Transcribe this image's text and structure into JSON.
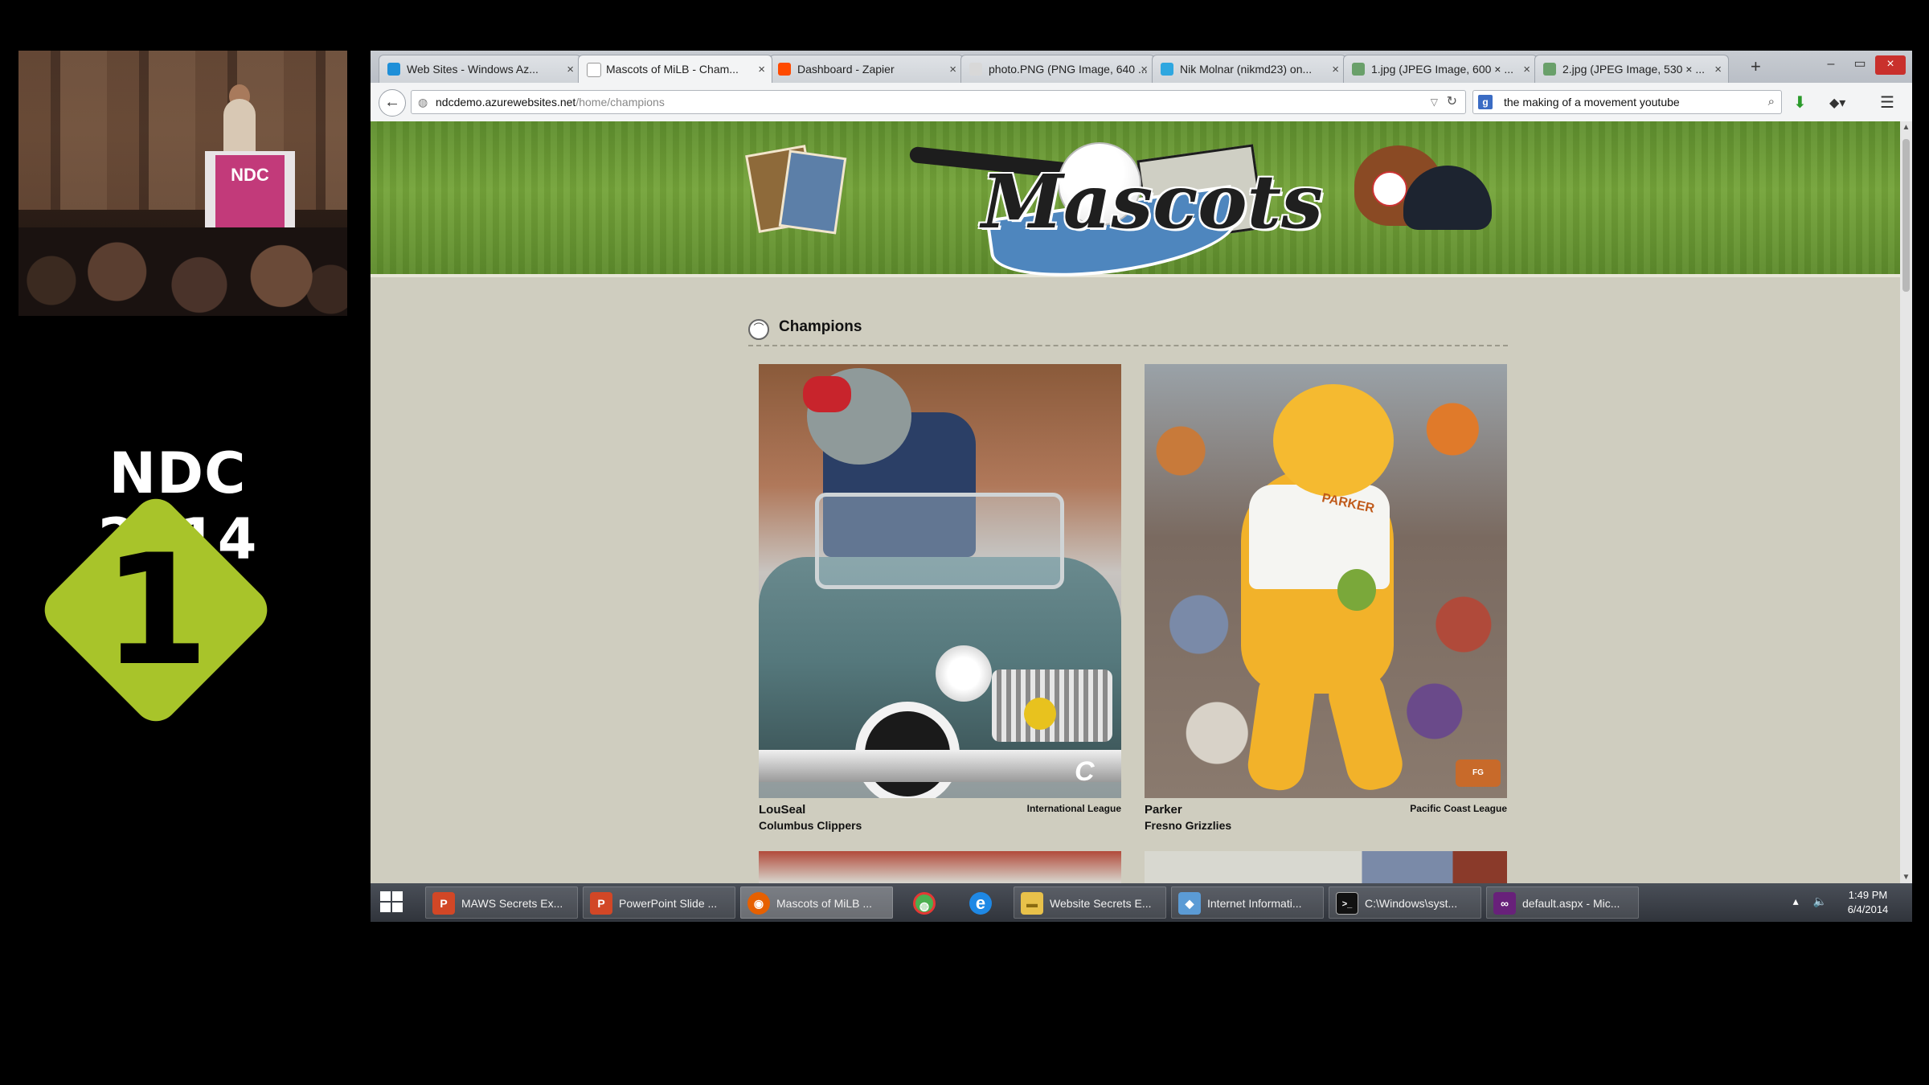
{
  "event": {
    "title": "NDC 2014",
    "badge_number": "1",
    "podium_logo": "NDC"
  },
  "browser": {
    "tabs": [
      {
        "label": "Web Sites - Windows Az...",
        "icon": "windows-azure-icon",
        "color": "#1e8fd8",
        "active": false
      },
      {
        "label": "Mascots of MiLB - Cham...",
        "icon": "baseball-icon",
        "color": "#777777",
        "active": true
      },
      {
        "label": "Dashboard - Zapier",
        "icon": "zapier-icon",
        "color": "#ff4a00",
        "active": false
      },
      {
        "label": "photo.PNG (PNG Image, 640 ...",
        "icon": "image-icon",
        "color": "#cccccc",
        "active": false
      },
      {
        "label": "Nik Molnar (nikmd23) on...",
        "icon": "twitter-icon",
        "color": "#2fa7e0",
        "active": false
      },
      {
        "label": "1.jpg (JPEG Image, 600 × ...",
        "icon": "image-icon",
        "color": "#6aa06a",
        "active": false
      },
      {
        "label": "2.jpg (JPEG Image, 530 × ...",
        "icon": "image-icon",
        "color": "#6aa06a",
        "active": false
      }
    ],
    "new_tab": "+",
    "window_controls": {
      "minimize": "–",
      "maximize": "▭",
      "close": "×"
    },
    "url": {
      "host": "ndcdemo.azurewebsites.net",
      "path": "/home/champions"
    },
    "search": {
      "value": "the making of a movement youtube",
      "engine": "g"
    }
  },
  "site": {
    "logo_text": "Mascots",
    "section_title": "Champions",
    "mascots": [
      {
        "name": "LouSeal",
        "team": "Columbus Clippers",
        "league": "International League"
      },
      {
        "name": "Parker",
        "team": "Fresno Grizzlies",
        "league": "Pacific Coast League",
        "shirt_text": "PARKER"
      }
    ]
  },
  "taskbar": {
    "items": [
      {
        "label": "MAWS Secrets Ex...",
        "icon": "powerpoint-icon",
        "color": "#d24726",
        "glyph": "P"
      },
      {
        "label": "PowerPoint Slide ...",
        "icon": "powerpoint-icon",
        "color": "#d24726",
        "glyph": "P"
      },
      {
        "label": "Mascots of MiLB ...",
        "icon": "firefox-icon",
        "color": "#e66000",
        "glyph": "◉"
      },
      {
        "label": "",
        "icon": "chrome-icon",
        "color": "#4caf50",
        "glyph": "◍"
      },
      {
        "label": "",
        "icon": "internet-explorer-icon",
        "color": "#1e88e5",
        "glyph": "e"
      },
      {
        "label": "Website Secrets E...",
        "icon": "folder-icon",
        "color": "#e8c14a",
        "glyph": "▬"
      },
      {
        "label": "Internet Informati...",
        "icon": "iis-icon",
        "color": "#5b9bd5",
        "glyph": "◆"
      },
      {
        "label": "C:\\Windows\\syst...",
        "icon": "command-prompt-icon",
        "color": "#111111",
        "glyph": ">_"
      },
      {
        "label": "default.aspx - Mic...",
        "icon": "visual-studio-icon",
        "color": "#68217a",
        "glyph": "∞"
      }
    ],
    "clock": {
      "time": "1:49 PM",
      "date": "6/4/2014"
    }
  }
}
